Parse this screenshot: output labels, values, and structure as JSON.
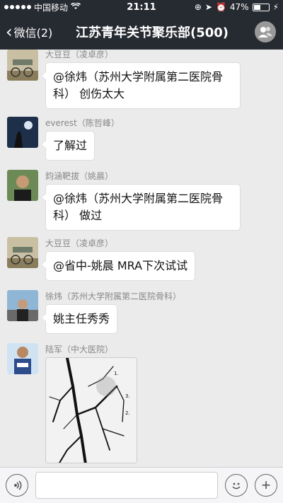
{
  "status_bar": {
    "carrier": "中国移动",
    "time": "21:11",
    "battery_percent": "47%",
    "battery_level": 0.47
  },
  "nav": {
    "back_label": "微信(2)",
    "title": "江苏青年关节聚乐部(500)"
  },
  "messages": [
    {
      "sender": "大豆豆（凌卓彦）",
      "lines": [
        "@徐炜（苏州大学附属第二医院骨",
        "科） 创伤太大"
      ]
    },
    {
      "sender": "everest（陈哲峰）",
      "lines": [
        "了解过"
      ]
    },
    {
      "sender": "鈞涵靶拔（姚晨）",
      "lines": [
        "@徐炜（苏州大学附属第二医院骨",
        "科） 做过"
      ]
    },
    {
      "sender": "大豆豆（凌卓彦）",
      "lines": [
        "@省中-姚晨 MRA下次试试"
      ]
    },
    {
      "sender": "徐炜（苏州大学附属第二医院骨科）",
      "lines": [
        "姚主任秀秀"
      ]
    },
    {
      "sender": "陆军（中大医院）",
      "image_labels": [
        "1.",
        "3.",
        "2."
      ]
    }
  ],
  "icons": {
    "voice": "voice-icon",
    "emoji": "emoji-icon",
    "plus": "plus-icon",
    "group": "group-members-icon",
    "back": "chevron-left-icon"
  }
}
